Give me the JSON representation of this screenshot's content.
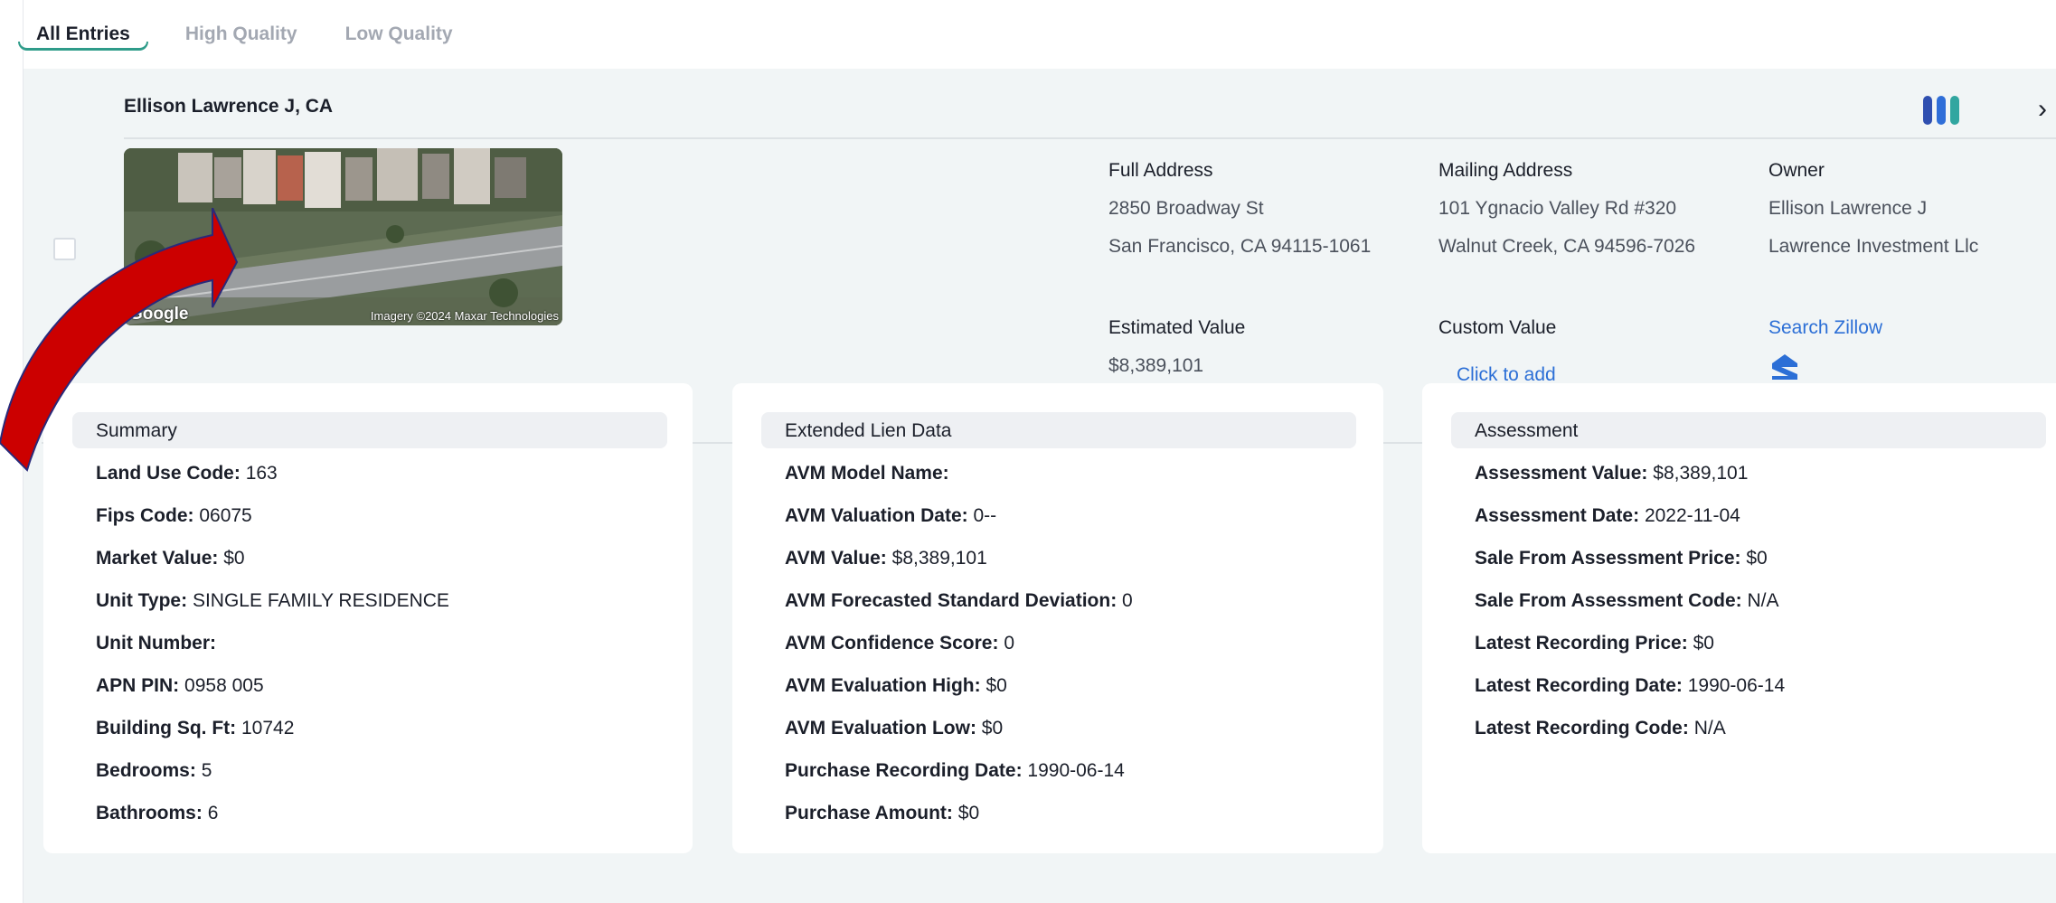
{
  "tabs": [
    {
      "label": "All Entries",
      "active": true
    },
    {
      "label": "High Quality",
      "active": false
    },
    {
      "label": "Low Quality",
      "active": false
    }
  ],
  "property": {
    "name": "Ellison Lawrence J, CA",
    "image": {
      "google": "Google",
      "credit": "Imagery ©2024 Maxar Technologies"
    },
    "full_address": {
      "label": "Full Address",
      "line1": "2850 Broadway St",
      "line2": "San Francisco, CA 94115-1061"
    },
    "mailing_address": {
      "label": "Mailing Address",
      "line1": "101 Ygnacio Valley Rd #320",
      "line2": "Walnut Creek, CA 94596-7026"
    },
    "owner": {
      "label": "Owner",
      "line1": "Ellison Lawrence J",
      "line2": "Lawrence Investment Llc"
    },
    "estimated_value": {
      "label": "Estimated Value",
      "value": "$8,389,101"
    },
    "custom_value": {
      "label": "Custom Value",
      "action": "Click to add"
    },
    "zillow": {
      "label": "Search Zillow",
      "icon": "zillow-icon"
    }
  },
  "icons": {
    "bars": "bars-icon",
    "chevron": "chevron-right-icon",
    "arrow": "red-arrow-annotation"
  },
  "colors": {
    "accent": "#2f9c8a",
    "link": "#2c6fd6",
    "bar1": "#2f4fb0",
    "bar2": "#2f6ed8",
    "bar3": "#31a6a0",
    "arrow": "#cc0000"
  },
  "panels": {
    "summary": {
      "title": "Summary",
      "rows": [
        {
          "label": "Land Use Code:",
          "value": "163"
        },
        {
          "label": "Fips Code:",
          "value": "06075"
        },
        {
          "label": "Market Value:",
          "value": "$0"
        },
        {
          "label": "Unit Type:",
          "value": "SINGLE FAMILY RESIDENCE"
        },
        {
          "label": "Unit Number:",
          "value": ""
        },
        {
          "label": "APN PIN:",
          "value": "0958 005"
        },
        {
          "label": "Building Sq. Ft:",
          "value": "10742"
        },
        {
          "label": "Bedrooms:",
          "value": "5"
        },
        {
          "label": "Bathrooms:",
          "value": "6"
        }
      ]
    },
    "lien": {
      "title": "Extended Lien Data",
      "rows": [
        {
          "label": "AVM Model Name:",
          "value": ""
        },
        {
          "label": "AVM Valuation Date:",
          "value": "0--"
        },
        {
          "label": "AVM Value:",
          "value": "$8,389,101"
        },
        {
          "label": "AVM Forecasted Standard Deviation:",
          "value": "0"
        },
        {
          "label": "AVM Confidence Score:",
          "value": "0"
        },
        {
          "label": "AVM Evaluation High:",
          "value": "$0"
        },
        {
          "label": "AVM Evaluation Low:",
          "value": "$0"
        },
        {
          "label": "Purchase Recording Date:",
          "value": "1990-06-14"
        },
        {
          "label": "Purchase Amount:",
          "value": "$0"
        }
      ]
    },
    "assessment": {
      "title": "Assessment",
      "rows": [
        {
          "label": "Assessment Value:",
          "value": "$8,389,101"
        },
        {
          "label": "Assessment Date:",
          "value": "2022-11-04"
        },
        {
          "label": "Sale From Assessment Price:",
          "value": "$0"
        },
        {
          "label": "Sale From Assessment Code:",
          "value": "N/A"
        },
        {
          "label": "Latest Recording Price:",
          "value": "$0"
        },
        {
          "label": "Latest Recording Date:",
          "value": "1990-06-14"
        },
        {
          "label": "Latest Recording Code:",
          "value": "N/A"
        }
      ]
    }
  }
}
